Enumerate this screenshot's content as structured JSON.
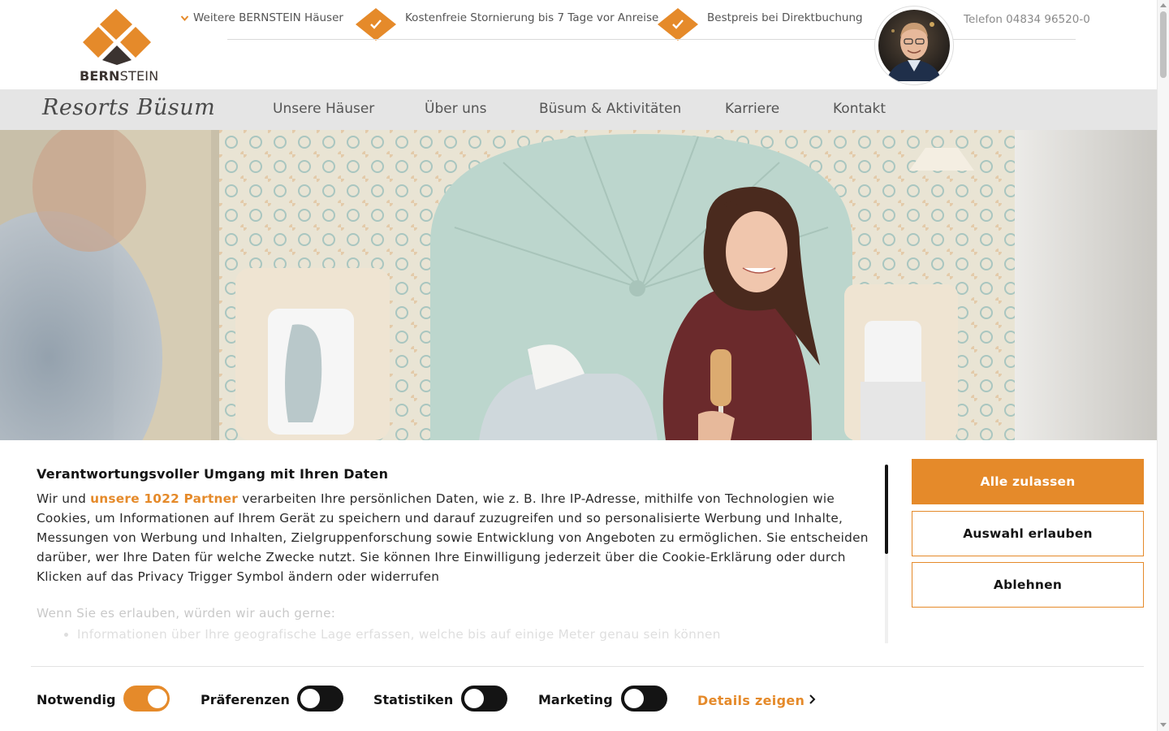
{
  "header": {
    "logo_text_bold": "BERN",
    "logo_text_rest": "STEIN",
    "more_houses": "Weitere BERNSTEIN Häuser",
    "usp1": "Kostenfreie Stornierung bis 7 Tage vor Anreise",
    "usp2": "Bestpreis bei Direktbuchung",
    "phone": "Telefon 04834 96520-0"
  },
  "nav": {
    "brand": "Resorts Büsum",
    "items": [
      "Unsere Häuser",
      "Über uns",
      "Büsum & Aktivitäten",
      "Karriere",
      "Kontakt"
    ]
  },
  "cookie": {
    "title": "Verantwortungsvoller Umgang mit Ihren Daten",
    "text_before_link": "Wir und ",
    "partners_link": "unsere 1022 Partner",
    "text_after_link": " verarbeiten Ihre persönlichen Daten, wie z. B. Ihre IP-Adresse, mithilfe von Technologien wie Cookies, um Informationen auf Ihrem Gerät zu speichern und darauf zuzugreifen und so personalisierte Werbung und Inhalte, Messungen von Werbung und Inhalten, Zielgruppenforschung sowie Entwicklung von Angeboten zu ermöglichen. Sie entscheiden darüber, wer Ihre Daten für welche Zwecke nutzt. Sie können Ihre Einwilligung jederzeit über die Cookie-Erklärung oder durch Klicken auf das Privacy Trigger Symbol ändern oder widerrufen",
    "para2": "Wenn Sie es erlauben, würden wir auch gerne:",
    "bullet1": "Informationen über Ihre geografische Lage erfassen, welche bis auf einige Meter genau sein können",
    "btn_allow_all": "Alle zulassen",
    "btn_allow_selection": "Auswahl erlauben",
    "btn_deny": "Ablehnen",
    "consents": [
      {
        "label": "Notwendig",
        "on": true
      },
      {
        "label": "Präferenzen",
        "on": false
      },
      {
        "label": "Statistiken",
        "on": false
      },
      {
        "label": "Marketing",
        "on": false
      }
    ],
    "details": "Details zeigen"
  },
  "colors": {
    "accent": "#e58a2a",
    "dark": "#141414"
  }
}
